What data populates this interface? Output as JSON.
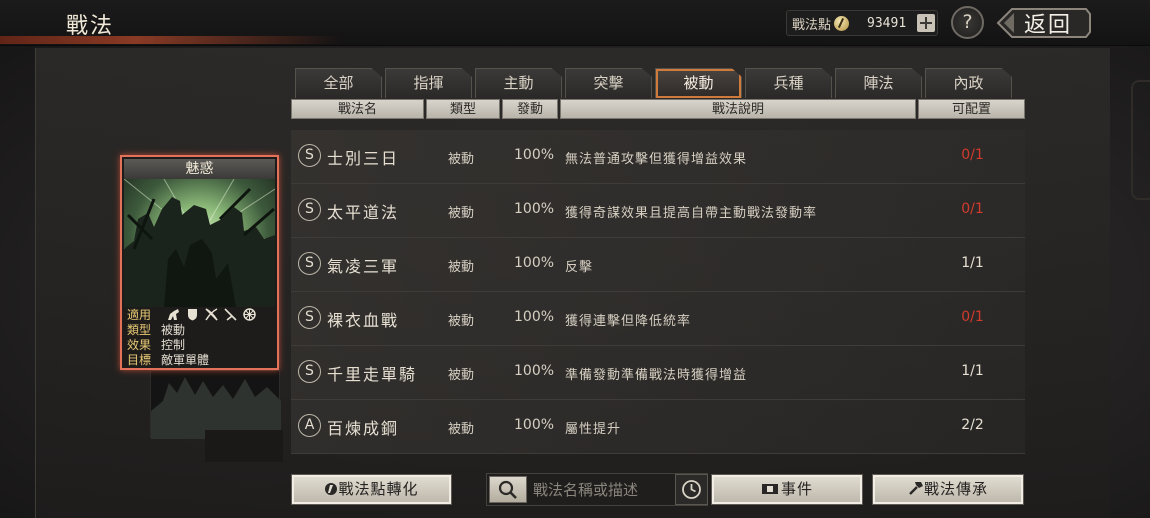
{
  "header": {
    "title": "戰法",
    "points_label": "戰法點",
    "points_value": "93491",
    "help_label": "?",
    "back_label": "返回"
  },
  "tabs": [
    {
      "label": "全部",
      "active": false
    },
    {
      "label": "指揮",
      "active": false
    },
    {
      "label": "主動",
      "active": false
    },
    {
      "label": "突擊",
      "active": false
    },
    {
      "label": "被動",
      "active": true
    },
    {
      "label": "兵種",
      "active": false
    },
    {
      "label": "陣法",
      "active": false
    },
    {
      "label": "內政",
      "active": false
    }
  ],
  "columns": {
    "name": "戰法名",
    "type": "類型",
    "rate": "發動",
    "desc": "戰法說明",
    "count": "可配置"
  },
  "rows": [
    {
      "grade": "S",
      "name": "士別三日",
      "type": "被動",
      "rate": "100%",
      "desc": "無法普通攻擊但獲得增益效果",
      "count": "0/1",
      "count_red": true
    },
    {
      "grade": "S",
      "name": "太平道法",
      "type": "被動",
      "rate": "100%",
      "desc": "獲得奇謀效果且提高自帶主動戰法發動率",
      "count": "0/1",
      "count_red": true
    },
    {
      "grade": "S",
      "name": "氣凌三軍",
      "type": "被動",
      "rate": "100%",
      "desc": "反擊",
      "count": "1/1",
      "count_red": false
    },
    {
      "grade": "S",
      "name": "裸衣血戰",
      "type": "被動",
      "rate": "100%",
      "desc": "獲得連擊但降低統率",
      "count": "0/1",
      "count_red": true
    },
    {
      "grade": "S",
      "name": "千里走單騎",
      "type": "被動",
      "rate": "100%",
      "desc": "準備發動準備戰法時獲得增益",
      "count": "1/1",
      "count_red": false
    },
    {
      "grade": "A",
      "name": "百煉成鋼",
      "type": "被動",
      "rate": "100%",
      "desc": "屬性提升",
      "count": "2/2",
      "count_red": false
    }
  ],
  "card": {
    "title": "魅惑",
    "applies_label": "適用",
    "unit_icons": [
      "cavalry-icon",
      "shield-icon",
      "crossed-bows-icon",
      "spear-icon",
      "wheel-icon"
    ],
    "type_label": "類型",
    "type_value": "被動",
    "effect_label": "效果",
    "effect_value": "控制",
    "target_label": "目標",
    "target_value": "敵軍單體"
  },
  "bottom": {
    "convert_label": "戰法點轉化",
    "search_placeholder": "戰法名稱或描述",
    "events_label": "事件",
    "inherit_label": "戰法傳承"
  },
  "colors": {
    "accent_orange": "#d07a3c",
    "card_border": "#e2735a",
    "count_red": "#d23a2c"
  }
}
